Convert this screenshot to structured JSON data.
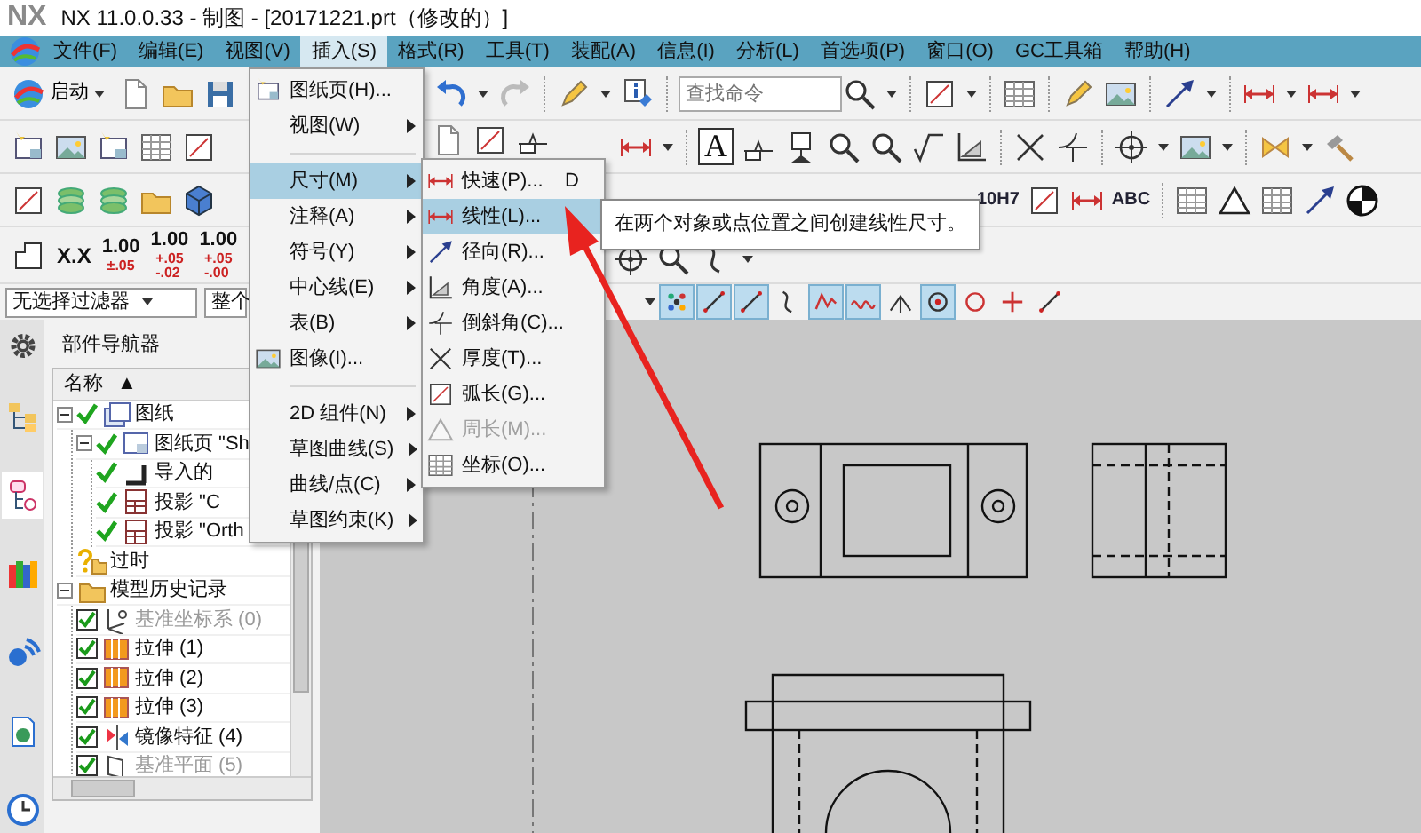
{
  "window": {
    "logo": "NX",
    "title": "NX 11.0.0.33 - 制图 - [20171221.prt（修改的）]"
  },
  "menubar": [
    {
      "label": "文件(F)",
      "selected": false
    },
    {
      "label": "编辑(E)",
      "selected": false
    },
    {
      "label": "视图(V)",
      "selected": false
    },
    {
      "label": "插入(S)",
      "selected": true
    },
    {
      "label": "格式(R)",
      "selected": false
    },
    {
      "label": "工具(T)",
      "selected": false
    },
    {
      "label": "装配(A)",
      "selected": false
    },
    {
      "label": "信息(I)",
      "selected": false
    },
    {
      "label": "分析(L)",
      "selected": false
    },
    {
      "label": "首选项(P)",
      "selected": false
    },
    {
      "label": "窗口(O)",
      "selected": false
    },
    {
      "label": "GC工具箱",
      "selected": false
    },
    {
      "label": "帮助(H)",
      "selected": false
    }
  ],
  "toolbar": {
    "start_button": "启动",
    "search": {
      "placeholder": "查找命令"
    },
    "note_label": "A",
    "fit_label": "10H7",
    "text_label": "ABC",
    "decimal_label": "X.X",
    "tolerances": [
      {
        "value": "1.00",
        "upper": "±.05"
      },
      {
        "value": "1.00",
        "upper": "+.05",
        "lower": "-.02"
      },
      {
        "value": "1.00",
        "upper": "+.05",
        "lower": "-.00"
      }
    ]
  },
  "selection_bar": {
    "filter": "无选择过滤器",
    "scope": "整个",
    "snap_points": [
      {
        "kind": "dots",
        "on": true
      },
      {
        "kind": "line",
        "on": true
      },
      {
        "kind": "line",
        "on": true
      },
      {
        "kind": "curve",
        "on": false
      },
      {
        "kind": "zigzag",
        "on": true
      },
      {
        "kind": "wave",
        "on": true
      },
      {
        "kind": "perp",
        "on": false
      },
      {
        "kind": "circledot",
        "on": true
      },
      {
        "kind": "circle",
        "on": false
      },
      {
        "kind": "plus",
        "on": false
      },
      {
        "kind": "line",
        "on": false
      }
    ]
  },
  "resource_tabs": [
    {
      "selected": false
    },
    {
      "selected": true
    },
    {
      "selected": false
    },
    {
      "selected": false
    },
    {
      "selected": false
    },
    {
      "selected": false
    }
  ],
  "part_navigator": {
    "title": "部件导航器",
    "column": "名称",
    "sort_indicator": "▲",
    "tree": [
      {
        "label": "图纸",
        "kind": "drawing",
        "checked": true,
        "disabled": false,
        "expanded": true,
        "children": [
          {
            "label": "图纸页 \"Sh",
            "kind": "sheet",
            "checked": true,
            "disabled": false,
            "expanded": true,
            "children": [
              {
                "label": "导入的",
                "kind": "imported",
                "checked": true,
                "disabled": false
              },
              {
                "label": "投影 \"C",
                "kind": "projected",
                "checked": true,
                "disabled": false
              },
              {
                "label": "投影 \"Orth",
                "kind": "projected",
                "checked": true,
                "disabled": false
              }
            ]
          },
          {
            "label": "过时",
            "kind": "outdated",
            "checked": false,
            "disabled": false
          }
        ]
      },
      {
        "label": "模型历史记录",
        "kind": "history",
        "checked": false,
        "disabled": false,
        "expanded": true,
        "children": [
          {
            "label": "基准坐标系 (0)",
            "kind": "csys",
            "checked": true,
            "disabled": true
          },
          {
            "label": "拉伸 (1)",
            "kind": "extrude",
            "checked": true,
            "disabled": false
          },
          {
            "label": "拉伸 (2)",
            "kind": "extrude",
            "checked": true,
            "disabled": false
          },
          {
            "label": "拉伸 (3)",
            "kind": "extrude",
            "checked": true,
            "disabled": false
          },
          {
            "label": "镜像特征 (4)",
            "kind": "mirror",
            "checked": true,
            "disabled": false
          },
          {
            "label": "基准平面 (5)",
            "kind": "plane",
            "checked": true,
            "disabled": true
          }
        ]
      }
    ]
  },
  "insert_menu": [
    {
      "kind": "item",
      "label": "图纸页(H)...",
      "selected": false
    },
    {
      "kind": "submenu",
      "label": "视图(W)",
      "selected": false
    },
    {
      "kind": "separator"
    },
    {
      "kind": "submenu",
      "label": "尺寸(M)",
      "selected": true
    },
    {
      "kind": "submenu",
      "label": "注释(A)",
      "selected": false
    },
    {
      "kind": "submenu",
      "label": "符号(Y)",
      "selected": false
    },
    {
      "kind": "submenu",
      "label": "中心线(E)",
      "selected": false
    },
    {
      "kind": "submenu",
      "label": "表(B)",
      "selected": false
    },
    {
      "kind": "item",
      "label": "图像(I)...",
      "selected": false
    },
    {
      "kind": "separator"
    },
    {
      "kind": "submenu",
      "label": "2D 组件(N)",
      "selected": false
    },
    {
      "kind": "submenu",
      "label": "草图曲线(S)",
      "selected": false
    },
    {
      "kind": "submenu",
      "label": "曲线/点(C)",
      "selected": false
    },
    {
      "kind": "submenu",
      "label": "草图约束(K)",
      "selected": false
    }
  ],
  "dimension_menu": [
    {
      "label": "快速(P)...",
      "shortcut": "D",
      "selected": false,
      "disabled": false
    },
    {
      "label": "线性(L)...",
      "selected": true,
      "disabled": false
    },
    {
      "label": "径向(R)...",
      "selected": false,
      "disabled": false
    },
    {
      "label": "角度(A)...",
      "selected": false,
      "disabled": false
    },
    {
      "label": "倒斜角(C)...",
      "selected": false,
      "disabled": false
    },
    {
      "label": "厚度(T)...",
      "selected": false,
      "disabled": false
    },
    {
      "label": "弧长(G)...",
      "selected": false,
      "disabled": false
    },
    {
      "label": "周长(M)...",
      "selected": false,
      "disabled": true
    },
    {
      "label": "坐标(O)...",
      "selected": false,
      "disabled": false
    }
  ],
  "tooltip": "在两个对象或点位置之间创建线性尺寸。"
}
